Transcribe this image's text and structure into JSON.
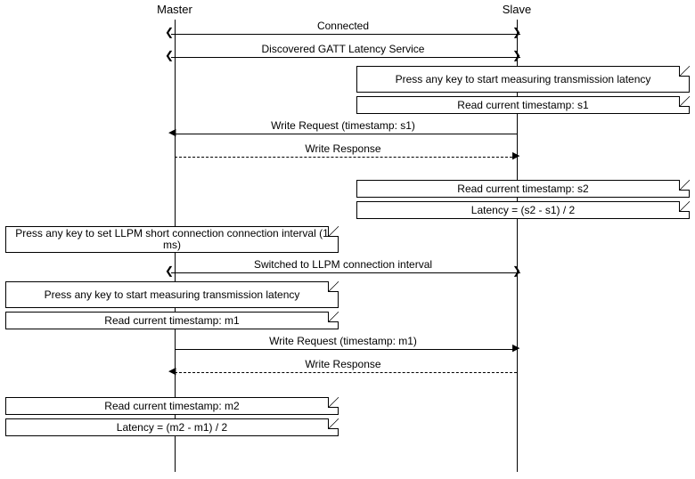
{
  "actors": {
    "master": "Master",
    "slave": "Slave"
  },
  "messages": {
    "connected": "Connected",
    "discovered": "Discovered GATT Latency Service",
    "write_req_s1": "Write Request (timestamp: s1)",
    "write_resp": "Write Response",
    "llpm_switch": "Switched to LLPM connection interval",
    "write_req_m1": "Write Request (timestamp: m1)"
  },
  "notes": {
    "slave_press": "Press any key to start measuring transmission latency",
    "read_s1": "Read current timestamp: s1",
    "read_s2": "Read current timestamp: s2",
    "latency_s": "Latency = (s2 - s1) / 2",
    "master_llpm": "Press any key to set LLPM short connection connection interval (1 ms)",
    "master_press": "Press any key to start measuring transmission latency",
    "read_m1": "Read current timestamp: m1",
    "read_m2": "Read current timestamp: m2",
    "latency_m": "Latency = (m2 - m1) / 2"
  }
}
